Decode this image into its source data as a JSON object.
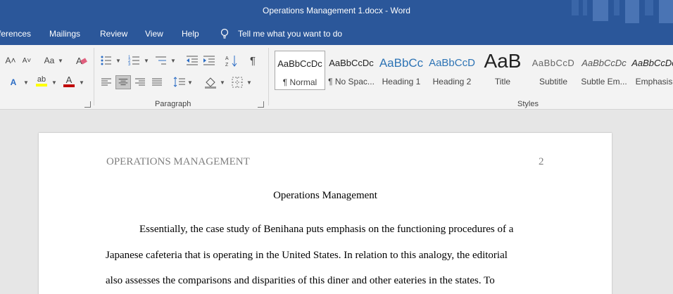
{
  "window": {
    "title": "Operations Management 1.docx  -  Word"
  },
  "tabs": {
    "items": [
      "ferences",
      "Mailings",
      "Review",
      "View",
      "Help"
    ],
    "tell_me": "Tell me what you want to do"
  },
  "ribbon": {
    "font_group": {
      "grow_font": "A˄",
      "shrink_font": "A˅",
      "change_case": "Aa",
      "text_effects": "A",
      "highlight": "ab",
      "font_color": "A"
    },
    "paragraph_group": {
      "label": "Paragraph",
      "show_marks": "¶"
    },
    "styles_group": {
      "label": "Styles",
      "items": [
        {
          "sample": "AaBbCcDc",
          "name": "¶ Normal"
        },
        {
          "sample": "AaBbCcDc",
          "name": "¶ No Spac..."
        },
        {
          "sample": "AaBbCc",
          "name": "Heading 1"
        },
        {
          "sample": "AaBbCcD",
          "name": "Heading 2"
        },
        {
          "sample": "AaB",
          "name": "Title"
        },
        {
          "sample": "AaBbCcD",
          "name": "Subtitle"
        },
        {
          "sample": "AaBbCcDc",
          "name": "Subtle Em..."
        },
        {
          "sample": "AaBbCcDc",
          "name": "Emphasis"
        }
      ]
    }
  },
  "colors": {
    "brand": "#2b579a",
    "highlight": "#ffff00",
    "font_color": "#c00000"
  },
  "document": {
    "header": "OPERATIONS MANAGEMENT",
    "page_number": "2",
    "title": "Operations Management",
    "lines": [
      "Essentially, the case study of Benihana puts emphasis on the functioning procedures of a",
      "Japanese cafeteria that is operating in the United States. In relation to this analogy, the editorial",
      "also assesses the comparisons and disparities of this diner and other eateries in the states. To"
    ]
  }
}
